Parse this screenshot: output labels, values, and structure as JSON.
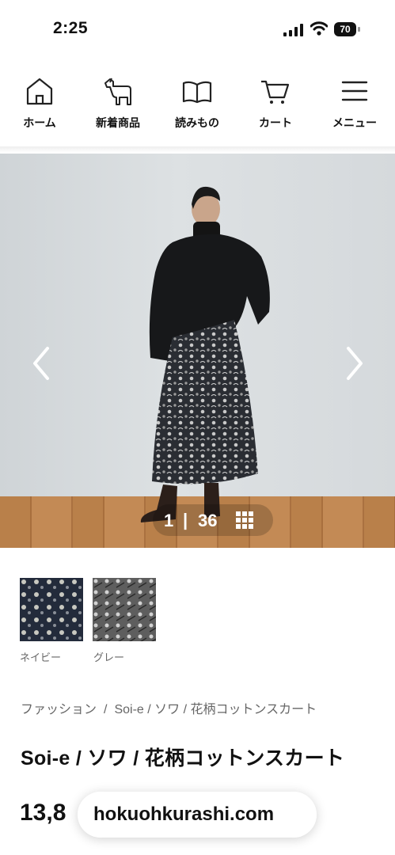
{
  "status_bar": {
    "time": "2:25",
    "battery": "70"
  },
  "nav": {
    "items": [
      {
        "label": "ホーム",
        "icon": "home-icon"
      },
      {
        "label": "新着商品",
        "icon": "horse-icon"
      },
      {
        "label": "読みもの",
        "icon": "book-icon"
      },
      {
        "label": "カート",
        "icon": "cart-icon"
      },
      {
        "label": "メニュー",
        "icon": "menu-icon"
      }
    ]
  },
  "gallery": {
    "current": "1",
    "separator": "|",
    "total": "36"
  },
  "colors": [
    {
      "label": "ネイビー",
      "swatch": "#2c3445"
    },
    {
      "label": "グレー",
      "swatch": "#6e6e6e"
    }
  ],
  "breadcrumb": {
    "items": [
      "ファッション",
      "Soi-e / ソワ / 花柄コットンスカート"
    ],
    "separator": "/"
  },
  "product": {
    "title": "Soi-e / ソワ / 花柄コットンスカート",
    "price": "13,8"
  },
  "browser": {
    "url": "hokuohkurashi.com"
  }
}
